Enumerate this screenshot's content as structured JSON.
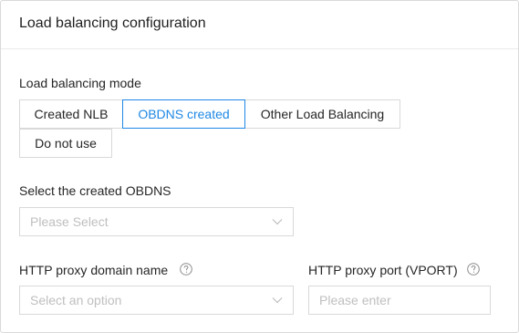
{
  "header": {
    "title": "Load balancing configuration"
  },
  "lb_mode": {
    "label": "Load balancing mode",
    "options": [
      "Created NLB",
      "OBDNS created",
      "Other Load Balancing",
      "Do not use"
    ],
    "selected": "OBDNS created"
  },
  "obdns_select": {
    "label": "Select the created OBDNS",
    "placeholder": "Please Select"
  },
  "http_domain": {
    "label": "HTTP proxy domain name",
    "placeholder": "Select an option",
    "help_icon": "question-circle-icon"
  },
  "http_port": {
    "label": "HTTP proxy port (VPORT)",
    "placeholder": "Please enter",
    "help_icon": "question-circle-icon"
  },
  "colors": {
    "accent": "#1e88e5",
    "border": "#d9d9d9",
    "placeholder": "#bfbfbf"
  }
}
